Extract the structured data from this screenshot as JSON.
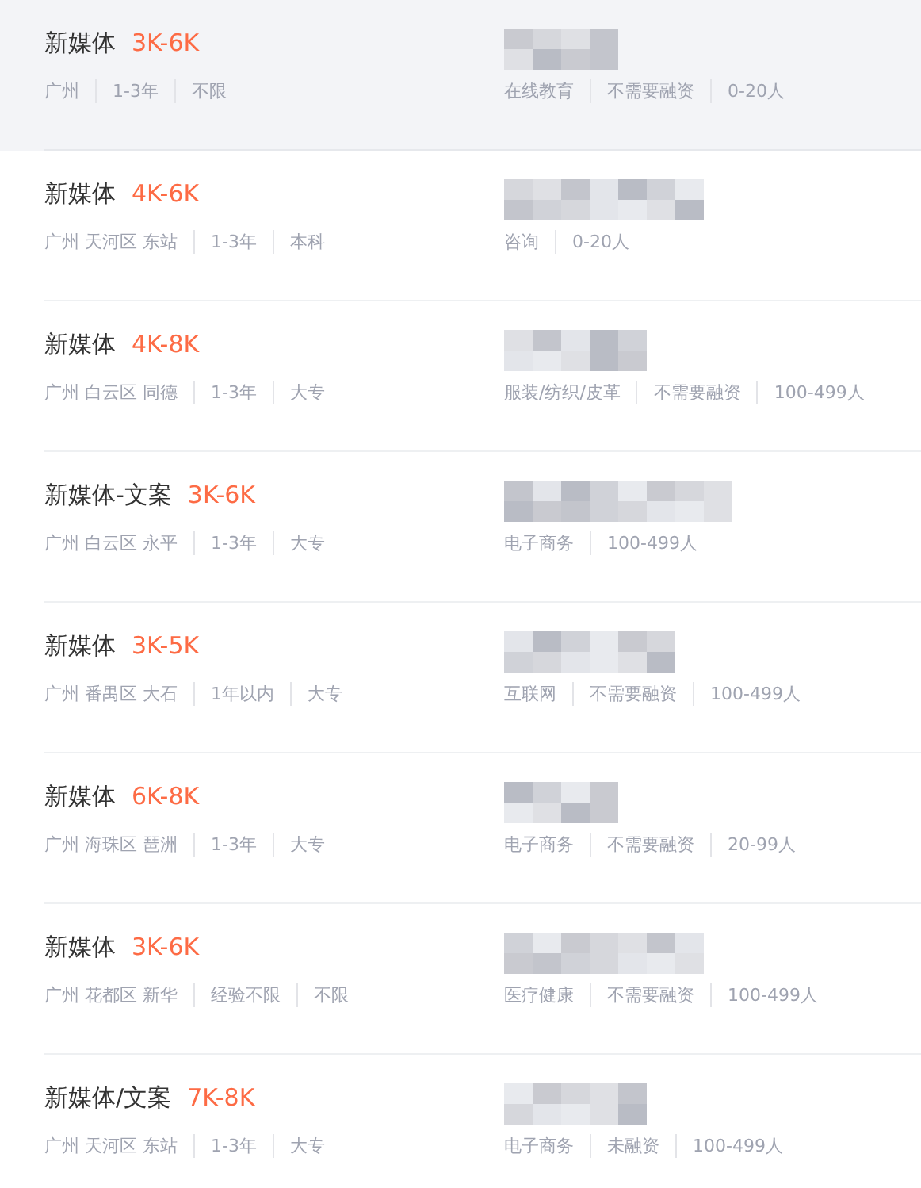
{
  "jobs": [
    {
      "title": "新媒体",
      "salary": "3K-6K",
      "meta": [
        "广州",
        "1-3年",
        "不限"
      ],
      "company_info": [
        "在线教育",
        "不需要融资",
        "0-20人"
      ],
      "selected": true
    },
    {
      "title": "新媒体",
      "salary": "4K-6K",
      "meta": [
        "广州 天河区 东站",
        "1-3年",
        "本科"
      ],
      "company_info": [
        "咨询",
        "0-20人"
      ],
      "selected": false
    },
    {
      "title": "新媒体",
      "salary": "4K-8K",
      "meta": [
        "广州 白云区 同德",
        "1-3年",
        "大专"
      ],
      "company_info": [
        "服装/纺织/皮革",
        "不需要融资",
        "100-499人"
      ],
      "selected": false
    },
    {
      "title": "新媒体-文案",
      "salary": "3K-6K",
      "meta": [
        "广州 白云区 永平",
        "1-3年",
        "大专"
      ],
      "company_info": [
        "电子商务",
        "100-499人"
      ],
      "selected": false
    },
    {
      "title": "新媒体",
      "salary": "3K-5K",
      "meta": [
        "广州 番禺区 大石",
        "1年以内",
        "大专"
      ],
      "company_info": [
        "互联网",
        "不需要融资",
        "100-499人"
      ],
      "selected": false
    },
    {
      "title": "新媒体",
      "salary": "6K-8K",
      "meta": [
        "广州 海珠区 琶洲",
        "1-3年",
        "大专"
      ],
      "company_info": [
        "电子商务",
        "不需要融资",
        "20-99人"
      ],
      "selected": false
    },
    {
      "title": "新媒体",
      "salary": "3K-6K",
      "meta": [
        "广州 花都区 新华",
        "经验不限",
        "不限"
      ],
      "company_info": [
        "医疗健康",
        "不需要融资",
        "100-499人"
      ],
      "selected": false
    },
    {
      "title": "新媒体/文案",
      "salary": "7K-8K",
      "meta": [
        "广州 天河区 东站",
        "1-3年",
        "大专"
      ],
      "company_info": [
        "电子商务",
        "未融资",
        "100-499人"
      ],
      "selected": false
    }
  ]
}
